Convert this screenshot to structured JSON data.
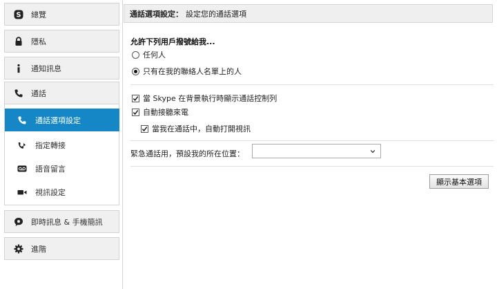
{
  "sidebar": {
    "items": [
      {
        "label": "總覽",
        "icon": "skype-icon"
      },
      {
        "label": "隱私",
        "icon": "lock-icon"
      },
      {
        "label": "通知訊息",
        "icon": "info-icon"
      },
      {
        "label": "通話",
        "icon": "phone-icon"
      },
      {
        "label": "即時訊息 & 手機簡訊",
        "icon": "chat-bubble-icon"
      },
      {
        "label": "進階",
        "icon": "gear-icon"
      }
    ],
    "call_subitems": [
      {
        "label": "通話選項設定",
        "icon": "phone-icon",
        "active": true
      },
      {
        "label": "指定轉接",
        "icon": "call-forward-icon",
        "active": false
      },
      {
        "label": "語音留言",
        "icon": "voicemail-icon",
        "active": false
      },
      {
        "label": "視訊設定",
        "icon": "video-camera-icon",
        "active": false
      }
    ]
  },
  "header": {
    "title_bold": "通話選項設定：",
    "title_rest": "設定您的通話選項"
  },
  "allow_calls": {
    "title": "允許下列用戶撥號給我...",
    "options": [
      {
        "label": "任何人",
        "checked": false
      },
      {
        "label": "只有在我的聯絡人名單上的人",
        "checked": true
      }
    ]
  },
  "checkboxes": [
    {
      "label": "當 Skype 在背景執行時顯示通話控制列",
      "checked": true
    },
    {
      "label": "自動接聽來電",
      "checked": true
    },
    {
      "label": "當我在通話中，自動打開視訊",
      "checked": true
    }
  ],
  "emergency": {
    "label": "緊急通話用，預設我的所在位置：",
    "value": ""
  },
  "advanced_button_label": "顯示基本選項",
  "colors": {
    "active_item": "#1587c6",
    "nav_bg": "#f0f0f0",
    "header_bg": "#efefef"
  }
}
